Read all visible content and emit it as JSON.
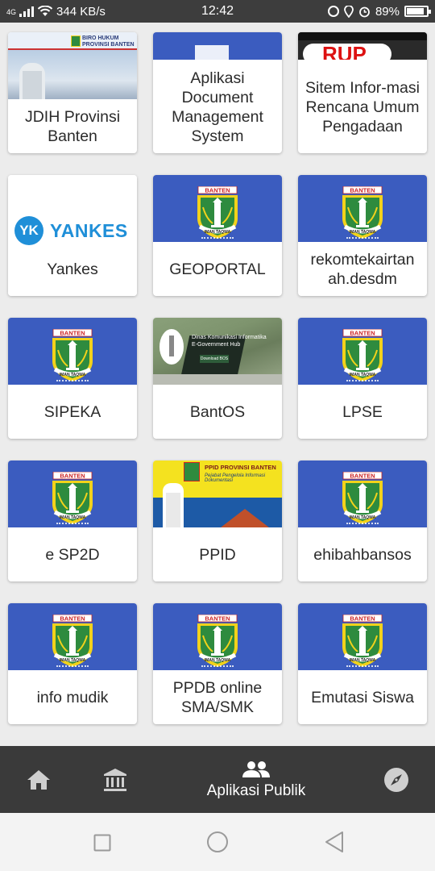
{
  "status_bar": {
    "network": "4G",
    "speed": "344 KB/s",
    "time": "12:42",
    "battery": "89%",
    "battery_level": 0.89
  },
  "apps": [
    {
      "label": "JDIH Provinsi Banten",
      "thumb": "jdih-banner",
      "banner_line1": "BIRO HUKUM",
      "banner_line2": "PROVINSI BANTEN"
    },
    {
      "label": "Aplikasi Document Management System",
      "thumb": "dms-blue"
    },
    {
      "label": "Sitem Infor-masi Rencana Umum Pengadaan",
      "thumb": "rup-banner",
      "banner_text": "RUP"
    },
    {
      "label": "Yankes",
      "thumb": "yankes-logo",
      "logo_mark": "YK",
      "logo_text": "YANKES"
    },
    {
      "label": "GEOPORTAL",
      "thumb": "banten-emblem"
    },
    {
      "label": "rekomtekairtan ah.desdm",
      "thumb": "banten-emblem"
    },
    {
      "label": "SIPEKA",
      "thumb": "banten-emblem"
    },
    {
      "label": "BantOS",
      "thumb": "bantos-photo",
      "overlay_line1": "Dinas Komunikasi Informatika",
      "overlay_line2": "E-Government Hub",
      "overlay_button": "Download BOS"
    },
    {
      "label": "LPSE",
      "thumb": "banten-emblem"
    },
    {
      "label": "e SP2D",
      "thumb": "banten-emblem"
    },
    {
      "label": "PPID",
      "thumb": "ppid-banner",
      "banner_title": "PPID PROVINSI BANTEN",
      "banner_subtitle": "Pejabat Pengelola Informasi Dokumentasi"
    },
    {
      "label": "ehibahbansos",
      "thumb": "banten-emblem"
    },
    {
      "label": "info mudik",
      "thumb": "banten-emblem"
    },
    {
      "label": "PPDB online SMA/SMK",
      "thumb": "banten-emblem"
    },
    {
      "label": "Emutasi Siswa",
      "thumb": "banten-emblem"
    }
  ],
  "emblem": {
    "top_text": "BANTEN",
    "bottom_text": "IMAN TAQWA"
  },
  "bottom_nav": {
    "items": [
      {
        "icon": "home-icon"
      },
      {
        "icon": "institution-icon"
      },
      {
        "icon": "people-icon",
        "label": "Aplikasi Publik",
        "active": true
      },
      {
        "icon": "compass-icon"
      }
    ]
  },
  "colors": {
    "thumb_blue": "#3b5cbf",
    "nav_bg": "#3a3a3a",
    "status_bg": "#3d3d3d",
    "emblem_green": "#2e8b3e",
    "emblem_yellow": "#f2d21b"
  }
}
